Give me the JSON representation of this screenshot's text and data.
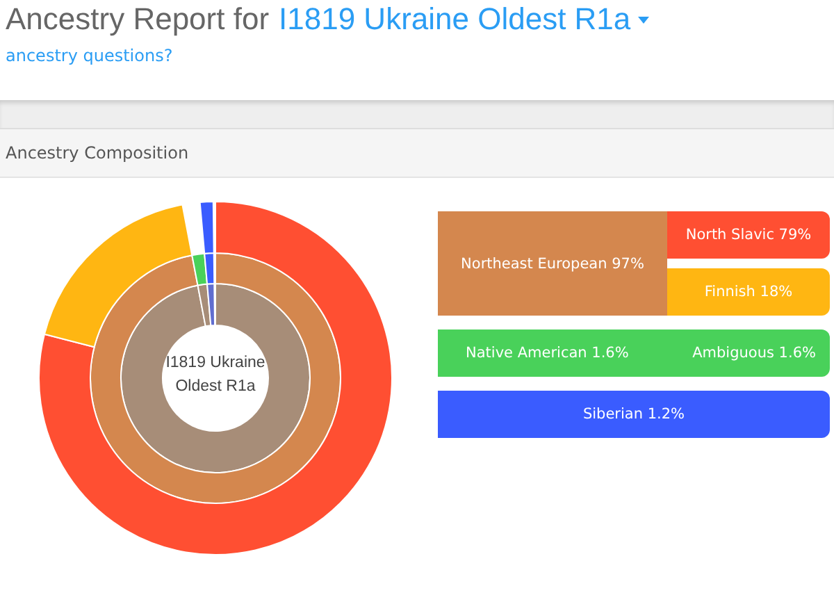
{
  "header": {
    "title_prefix": "Ancestry Report for",
    "sample_name": "I1819 Ukraine Oldest R1a",
    "help_link": "ancestry questions?"
  },
  "panel": {
    "title": "Ancestry Composition"
  },
  "chart": {
    "center_label": "I1819 Ukraine Oldest R1a"
  },
  "groups": [
    {
      "label": "Northeast European 97%",
      "color": "#d4874e",
      "children": [
        {
          "label": "North Slavic 79%",
          "color": "#ff4f32",
          "kind": "assigned"
        },
        {
          "label": "Finnish 18%",
          "color": "#ffb612",
          "kind": "assigned"
        }
      ]
    },
    {
      "label": "Native American 1.6%",
      "color": "#49d15a",
      "children": [
        {
          "label": "Ambiguous 1.6%",
          "kind": "ambiguous"
        }
      ]
    },
    {
      "label": "Siberian 1.2%",
      "color": "#3a5cff"
    }
  ]
}
